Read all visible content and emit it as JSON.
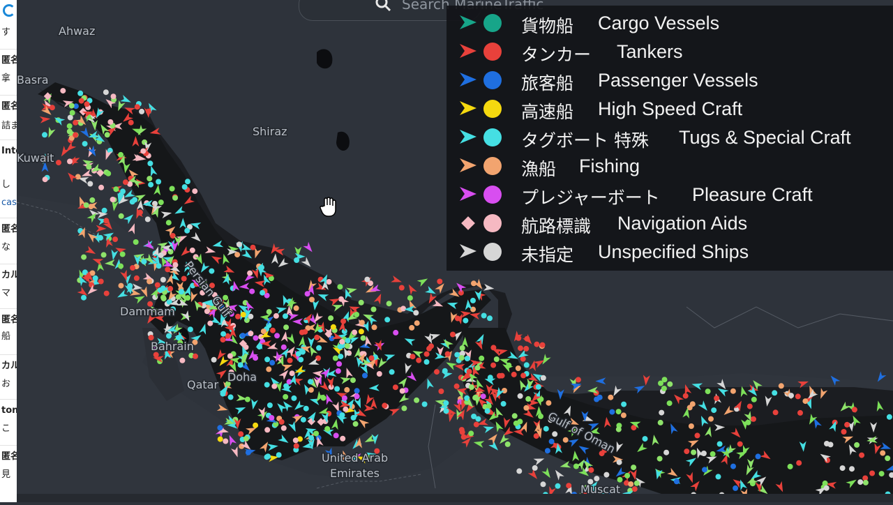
{
  "search": {
    "placeholder": "Search MarineTraffic"
  },
  "places": [
    {
      "name": "Ahwaz"
    },
    {
      "name": "Basra"
    },
    {
      "name": "Shiraz"
    },
    {
      "name": "Kuwait"
    },
    {
      "name": "Dammam"
    },
    {
      "name": "Bahrain"
    },
    {
      "name": "Qatar"
    },
    {
      "name": "Doha"
    },
    {
      "name": "United Arab"
    },
    {
      "name": "Emirates"
    },
    {
      "name": "Muscat"
    },
    {
      "name": "Persian Gulf"
    },
    {
      "name": "Gulf of Oman"
    }
  ],
  "legend": [
    {
      "jp": "貨物船",
      "en": "Cargo Vessels",
      "color": "#17a589",
      "arrow": "#17a589"
    },
    {
      "jp": "タンカー",
      "en": "Tankers",
      "color": "#e8413b",
      "arrow": "#e8413b"
    },
    {
      "jp": "旅客船",
      "en": "Passenger Vessels",
      "color": "#1f6fe0",
      "arrow": "#1f6fe0"
    },
    {
      "jp": "高速船",
      "en": "High Speed Craft",
      "color": "#f5d90f",
      "arrow": "#f5d90f"
    },
    {
      "jp": "タグボート 特殊",
      "en": "Tugs & Special Craft",
      "color": "#45dfe3",
      "arrow": "#45dfe3"
    },
    {
      "jp": "漁船",
      "en": "Fishing",
      "color": "#f2a46f",
      "arrow": "#f2a46f"
    },
    {
      "jp": "プレジャーボート",
      "en": "Pleasure Craft",
      "color": "#d84ef0",
      "arrow": "#d84ef0"
    },
    {
      "jp": "航路標識",
      "en": "Navigation Aids",
      "color": "#f6b9c2",
      "arrow": "#f6b9c2",
      "diamond": true
    },
    {
      "jp": "未指定",
      "en": "Unspecified Ships",
      "color": "#d6d6d6",
      "arrow": "#d6d6d6"
    }
  ],
  "sidebar": {
    "rows": [
      "す",
      "匿名",
      "拿",
      "匿名",
      "詰ま",
      "Inte",
      "し",
      "cas",
      "匿名",
      "な",
      "カル",
      "マ",
      "匿名",
      "船",
      "カル",
      "お",
      "ton",
      "こ",
      "匿名",
      "見"
    ]
  }
}
